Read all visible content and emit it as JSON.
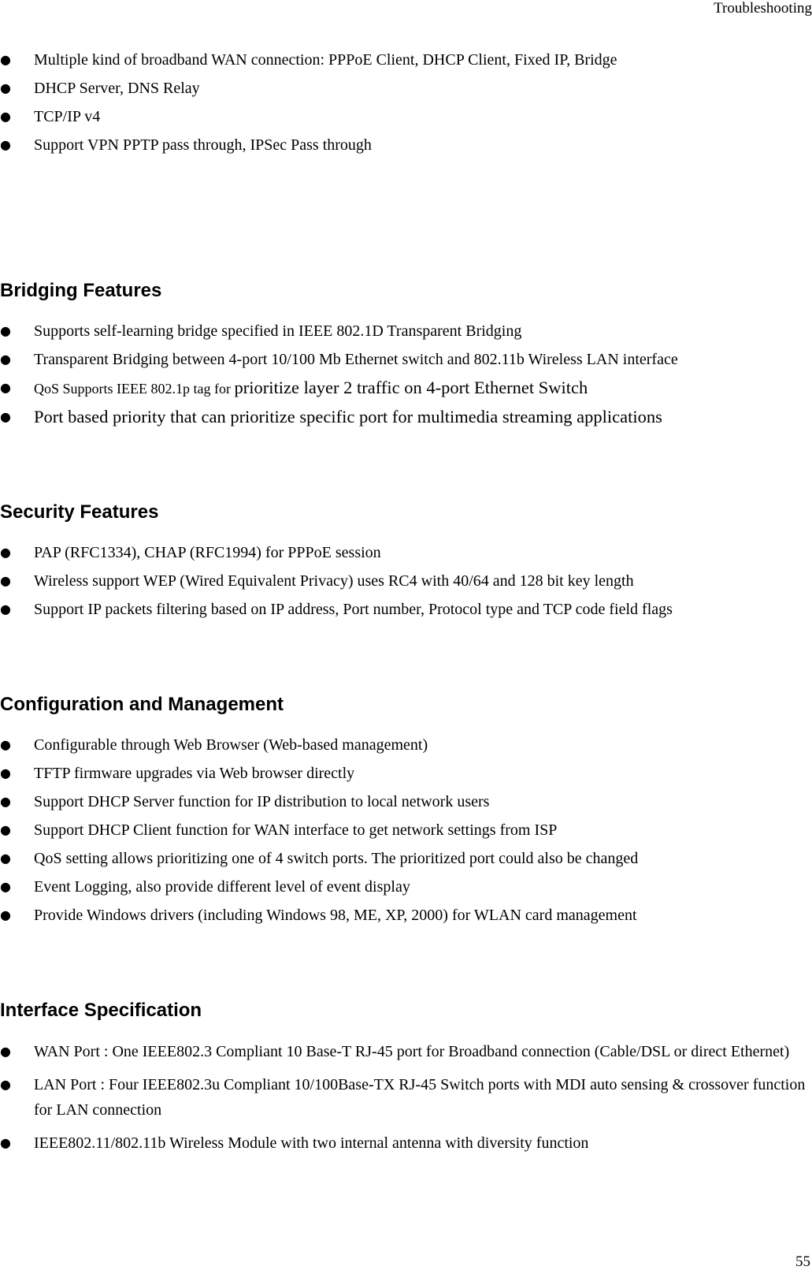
{
  "header": {
    "title": "Troubleshooting"
  },
  "footer": {
    "page_number": "55"
  },
  "bullet_glyph": "●",
  "intro_list": [
    "Multiple kind of broadband WAN connection: PPPoE Client, DHCP Client, Fixed IP, Bridge",
    "DHCP Server, DNS Relay",
    "TCP/IP v4",
    "Support VPN PPTP pass through, IPSec Pass through"
  ],
  "sections": [
    {
      "title": "Bridging Features",
      "items": [
        "Supports self-learning bridge specified in IEEE 802.1D Transparent Bridging",
        "Transparent Bridging between 4-port 10/100 Mb Ethernet switch and 802.11b Wireless LAN interface",
        {
          "part1": "QoS Supports IEEE 802.1p tag for ",
          "part2": "prioritize layer 2 traffic on 4-port Ethernet Switch"
        },
        "Port based priority that can prioritize specific port for multimedia streaming applications"
      ]
    },
    {
      "title": "Security Features",
      "items": [
        "PAP (RFC1334), CHAP (RFC1994) for PPPoE session",
        "Wireless support WEP (Wired Equivalent Privacy) uses RC4 with 40/64 and 128 bit key length",
        "Support IP packets filtering based on IP address, Port number, Protocol type and TCP code field flags"
      ]
    },
    {
      "title": "Configuration and Management",
      "items": [
        "Configurable through Web Browser (Web-based management)",
        "TFTP firmware upgrades via Web browser directly",
        "Support DHCP Server function for IP distribution to local network users",
        "Support DHCP Client function for WAN interface to get network settings from ISP",
        "QoS setting allows prioritizing one of 4 switch ports. The prioritized port could also be changed",
        "Event Logging, also provide different level of event display",
        "Provide Windows drivers (including Windows 98, ME, XP, 2000) for WLAN card management"
      ]
    },
    {
      "title": "Interface Specification",
      "items": [
        "WAN Port : One IEEE802.3 Compliant 10 Base-T RJ-45 port for Broadband connection (Cable/DSL or direct Ethernet)",
        "LAN Port : Four IEEE802.3u Compliant 10/100Base-TX RJ-45 Switch ports with MDI auto sensing & crossover function for LAN connection",
        "IEEE802.11/802.11b Wireless Module with two internal antenna with diversity function"
      ]
    }
  ]
}
